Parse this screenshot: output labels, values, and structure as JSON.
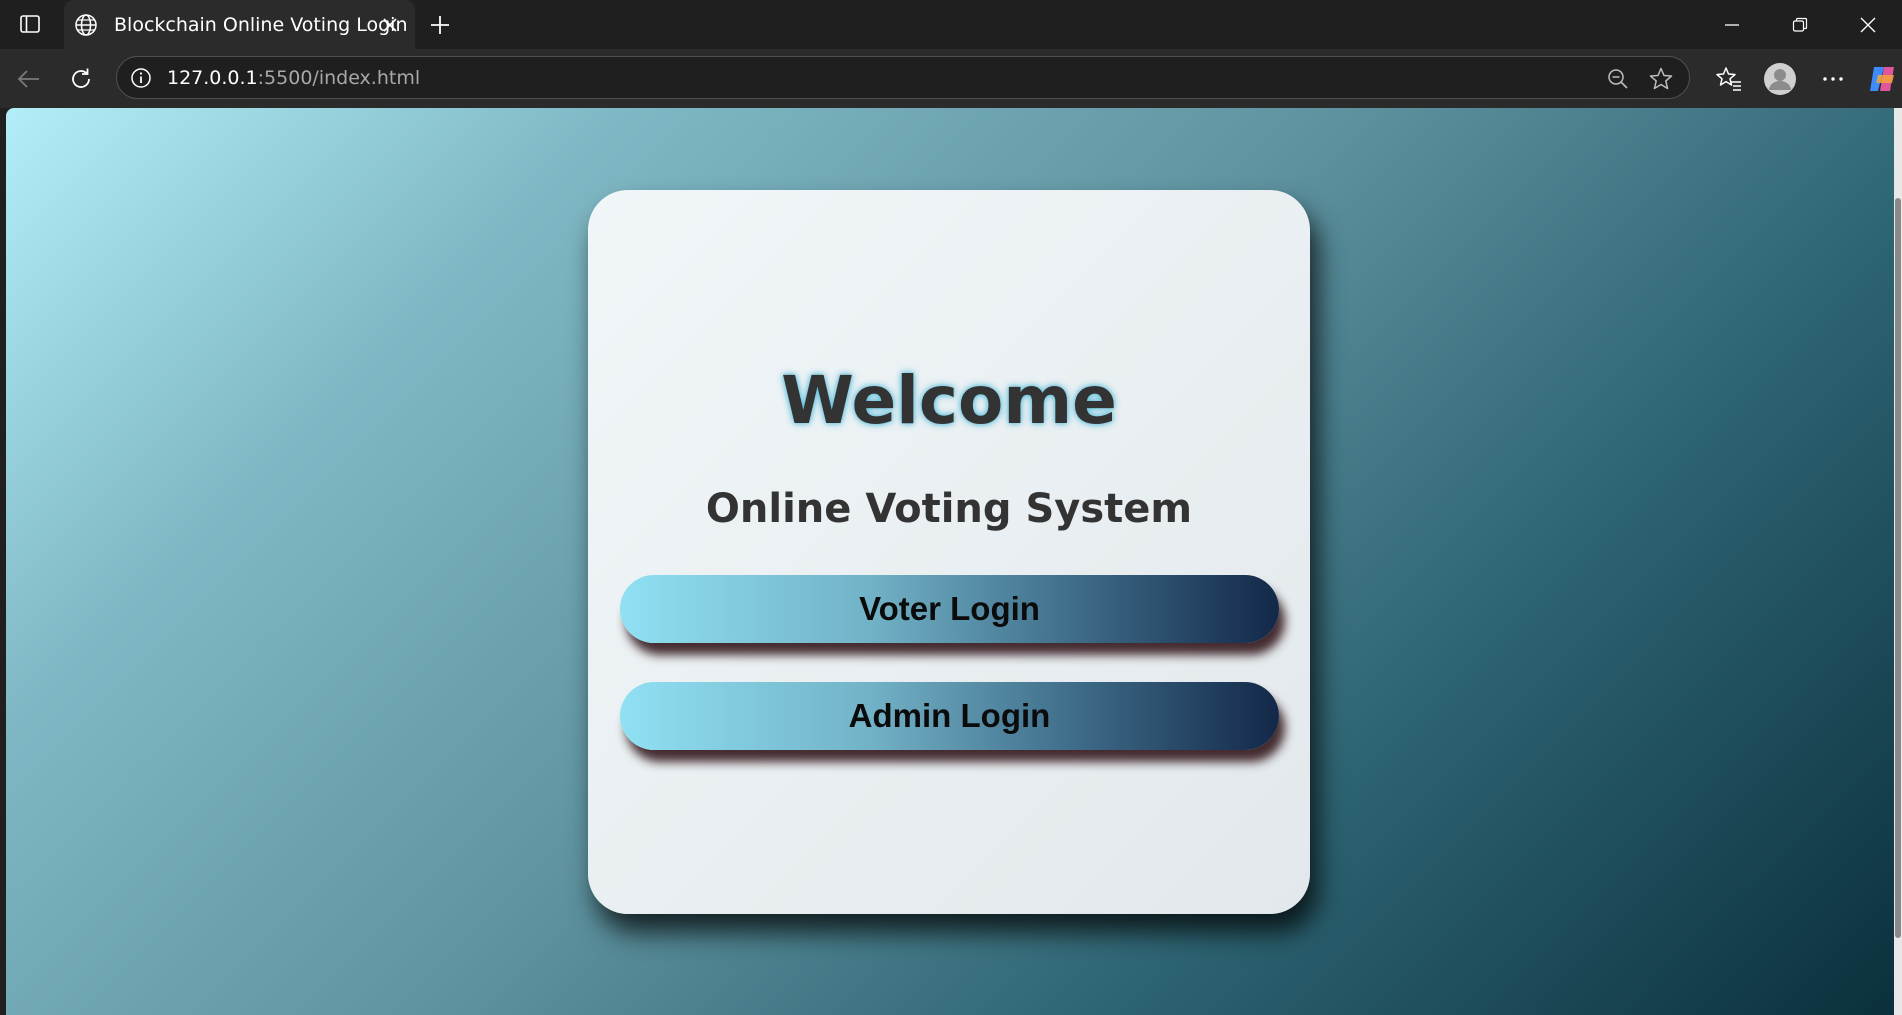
{
  "browser": {
    "tab": {
      "title": "Blockchain Online Voting Login",
      "favicon": "globe-icon"
    },
    "address": {
      "host": "127.0.0.1",
      "path": ":5500/index.html"
    },
    "icons": {
      "tab_actions": "tab-actions-icon",
      "new_tab": "plus-icon",
      "back": "back-arrow-icon",
      "reload": "reload-icon",
      "site_info": "info-icon",
      "zoom": "zoom-out-icon",
      "favorite": "star-icon",
      "favorites_list": "favorites-icon",
      "profile": "avatar",
      "menu": "more-icon",
      "copilot": "copilot-icon",
      "minimize": "minimize-icon",
      "restore": "restore-icon",
      "close": "close-icon"
    }
  },
  "page": {
    "welcome": "Welcome",
    "subtitle": "Online Voting System",
    "buttons": {
      "voter": "Voter Login",
      "admin": "Admin Login"
    }
  },
  "colors": {
    "background_start": "#b3eef8",
    "background_end": "#0b2f3d",
    "card": "#eaf1f3",
    "button_start": "#90e0f3",
    "button_end": "#132848",
    "heading_text": "#333333",
    "heading_glow": "#5abedc"
  }
}
